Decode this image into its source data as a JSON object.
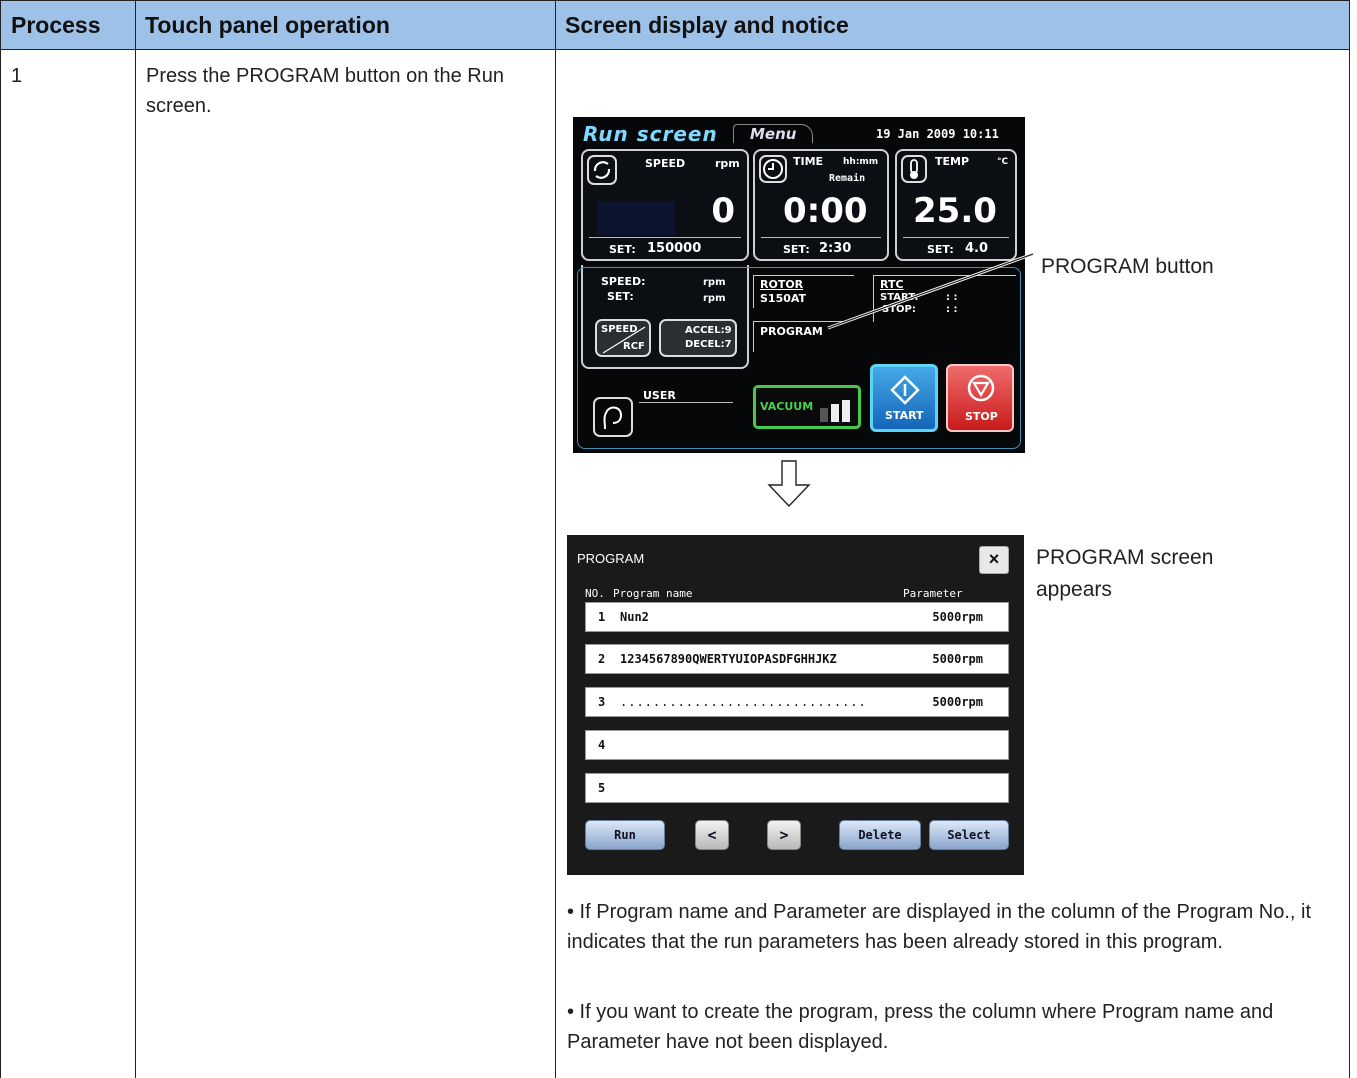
{
  "table": {
    "headers": [
      "Process",
      "Touch panel operation",
      "Screen display and notice"
    ],
    "process_number": "1",
    "operation_text": "Press the PROGRAM button on the Run screen."
  },
  "run_screen": {
    "title": "Run screen",
    "menu_tab": "Menu",
    "datetime": "19  Jan  2009  10:11",
    "speed": {
      "label": "SPEED",
      "unit": "rpm",
      "value": "0",
      "set_label": "SET:",
      "set_value": "150000"
    },
    "time": {
      "label": "TIME",
      "unit": "hh:mm",
      "sub": "Remain",
      "value": "0:00",
      "set_label": "SET:",
      "set_value": "2:30"
    },
    "temp": {
      "label": "TEMP",
      "unit": "°C",
      "value": "25.0",
      "set_label": "SET:",
      "set_value": "4.0"
    },
    "speed_info": {
      "speed_label": "SPEED:",
      "speed_unit": "rpm",
      "set_label": "SET:",
      "set_unit": "rpm"
    },
    "rotor": {
      "label": "ROTOR",
      "value": "S150AT"
    },
    "rtc": {
      "label": "RTC",
      "start_label": "START:",
      "stop_label": "STOP:",
      "start_value": ":    :",
      "stop_value": ":    :"
    },
    "program_label": "PROGRAM",
    "speed_rcf": {
      "top": "SPEED",
      "bottom": "RCF"
    },
    "accel": "ACCEL:9",
    "decel": "DECEL:7",
    "user_label": "USER",
    "vacuum_label": "VACUUM",
    "start_label": "START",
    "stop_label": "STOP"
  },
  "callouts": {
    "program_button": "PROGRAM button",
    "program_screen_line1": "PROGRAM screen",
    "program_screen_line2": "appears"
  },
  "program_screen": {
    "title": "PROGRAM",
    "close": "×",
    "col_no": "NO.",
    "col_name": "Program name",
    "col_param": "Parameter",
    "rows": [
      {
        "no": "1",
        "name": "Nun2",
        "param": "5000rpm"
      },
      {
        "no": "2",
        "name": "1234567890QWERTYUIOPASDFGHHJKZ",
        "param": "5000rpm"
      },
      {
        "no": "3",
        "name": "..............................",
        "param": "5000rpm"
      },
      {
        "no": "4",
        "name": "",
        "param": ""
      },
      {
        "no": "5",
        "name": "",
        "param": ""
      }
    ],
    "buttons": {
      "run": "Run",
      "prev": "<",
      "next": ">",
      "delete": "Delete",
      "select": "Select"
    }
  },
  "notes": [
    "• If Program name and Parameter are displayed in the column of the Program No., it indicates that the run parameters has been already stored in this program.",
    "• If you want to create the program, press the column where Program name and Parameter have not been displayed."
  ]
}
